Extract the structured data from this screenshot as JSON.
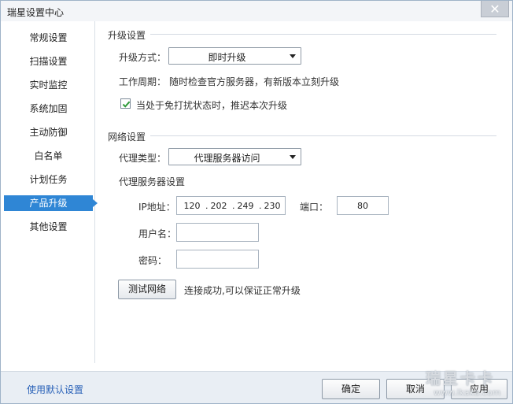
{
  "window": {
    "title": "瑞星设置中心",
    "close_symbol": "✕"
  },
  "sidebar": {
    "items": [
      {
        "label": "常规设置"
      },
      {
        "label": "扫描设置"
      },
      {
        "label": "实时监控"
      },
      {
        "label": "系统加固"
      },
      {
        "label": "主动防御"
      },
      {
        "label": "白名单"
      },
      {
        "label": "计划任务"
      },
      {
        "label": "产品升级"
      },
      {
        "label": "其他设置"
      }
    ],
    "active_index": 7
  },
  "upgrade": {
    "section_title": "升级设置",
    "method_label": "升级方式：",
    "method_value": "即时升级",
    "cycle_label": "工作周期：",
    "cycle_text": "随时检查官方服务器，有新版本立刻升级",
    "defer_checked": true,
    "defer_label": "当处于免打扰状态时，推迟本次升级"
  },
  "network": {
    "section_title": "网络设置",
    "proxy_type_label": "代理类型：",
    "proxy_type_value": "代理服务器访问",
    "proxy_settings_label": "代理服务器设置",
    "ip_label": "IP地址：",
    "ip_parts": [
      "120",
      "202",
      "249",
      "230"
    ],
    "ip_dot": ".",
    "port_label": "端口：",
    "port_value": "80",
    "username_label": "用户名：",
    "username_value": "",
    "password_label": "密码：",
    "password_value": "",
    "test_button": "测试网络",
    "test_result": "连接成功,可以保证正常升级"
  },
  "footer": {
    "default_link": "使用默认设置",
    "ok_button": "确定",
    "cancel_button": "取消",
    "apply_button": "应用"
  },
  "watermark": {
    "brand": "瑞星卡卡",
    "url": "www.ikaka.com"
  },
  "colors": {
    "accent": "#2f86d5",
    "link": "#2a62b8",
    "footer_bg": "#e9eef4"
  }
}
